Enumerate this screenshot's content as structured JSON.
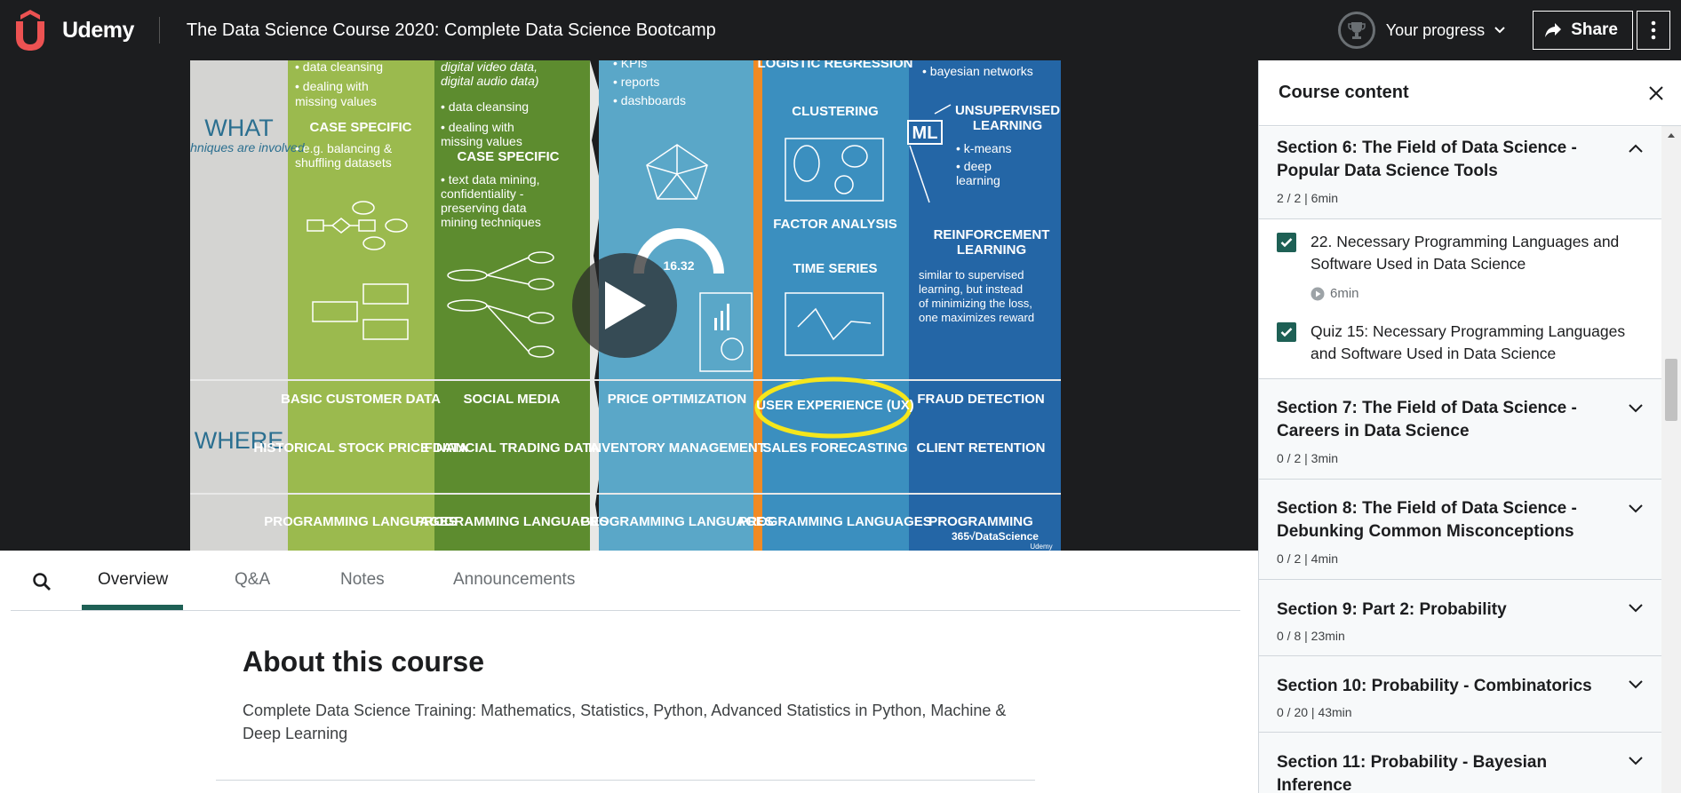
{
  "header": {
    "brand": "Udemy",
    "course_title": "The Data Science Course 2020: Complete Data Science Bootcamp",
    "progress_label": "Your progress",
    "share_label": "Share"
  },
  "video": {
    "rows": [
      "WHAT",
      "WHERE"
    ],
    "what_sub": "techniques are involved",
    "col1_top": [
      "• data cleansing",
      "• dealing with",
      "  missing values"
    ],
    "col1_case": "CASE SPECIFIC",
    "col1_case_items": [
      "• e.g. balancing &",
      "  shuffling datasets"
    ],
    "col2_top": [
      "digital video data,",
      "digital audio data)",
      "• data cleansing",
      "• dealing with",
      "  missing values"
    ],
    "col2_case": "CASE SPECIFIC",
    "col2_case_items": [
      "• text data mining,",
      "  confidentiality -",
      "  preserving data",
      "  mining techniques"
    ],
    "col3_top": [
      "• KPIs",
      "• reports",
      "• dashboards"
    ],
    "col3_gauge": "16.32",
    "col4_items": [
      "LOGISTIC REGRESSION",
      "CLUSTERING",
      "FACTOR ANALYSIS",
      "TIME SERIES"
    ],
    "col5_top": "• bayesian networks",
    "col5_ml": "ML",
    "col5_unsup": "UNSUPERVISED LEARNING",
    "col5_unsup_items": [
      "• k-means",
      "• deep",
      "  learning"
    ],
    "col5_reinf": "REINFORCEMENT LEARNING",
    "col5_reinf_desc": [
      "similar to supervised",
      "learning, but instead",
      "of minimizing the loss,",
      "one maximizes reward"
    ],
    "where_row1": [
      "BASIC CUSTOMER DATA",
      "SOCIAL MEDIA",
      "PRICE OPTIMIZATION",
      "USER EXPERIENCE (UX)",
      "FRAUD DETECTION"
    ],
    "where_row2": [
      "HISTORICAL STOCK PRICE DATA",
      "FINANCIAL TRADING DATA",
      "INVENTORY MANAGEMENT",
      "SALES FORECASTING",
      "CLIENT RETENTION"
    ],
    "bottom_row": [
      "PROGRAMMING LANGUAGES",
      "PROGRAMMING LANGUAGES",
      "PROGRAMMING LANGUAGES",
      "PROGRAMMING LANGUAGES",
      "PROGRAMMING"
    ],
    "watermark": "365√DataScience",
    "watermark_small": "Udemy"
  },
  "tabs": [
    "Overview",
    "Q&A",
    "Notes",
    "Announcements"
  ],
  "about": {
    "title": "About this course",
    "description": "Complete Data Science Training: Mathematics, Statistics, Python, Advanced Statistics in Python, Machine & Deep Learning"
  },
  "sidebar": {
    "title": "Course content",
    "sections": [
      {
        "title": "Section 6: The Field of Data Science - Popular Data Science Tools",
        "meta": "2 / 2 | 6min",
        "expanded": true
      },
      {
        "title": "Section 7: The Field of Data Science - Careers in Data Science",
        "meta": "0 / 2 | 3min"
      },
      {
        "title": "Section 8: The Field of Data Science - Debunking Common Misconceptions",
        "meta": "0 / 2 | 4min"
      },
      {
        "title": "Section 9: Part 2: Probability",
        "meta": "0 / 8 | 23min"
      },
      {
        "title": "Section 10: Probability - Combinatorics",
        "meta": "0 / 20 | 43min"
      },
      {
        "title": "Section 11: Probability - Bayesian Inference",
        "meta": ""
      }
    ],
    "lectures": [
      {
        "title": "22. Necessary Programming Languages and Software Used in Data Science",
        "duration": "6min",
        "checked": true
      },
      {
        "title": "Quiz 15: Necessary Programming Languages and Software Used in Data Science",
        "duration": "",
        "checked": true
      }
    ]
  },
  "colors": {
    "header_bg": "#1c1d1f",
    "brand_red": "#ec5252",
    "checkbox": "#1e6055",
    "col1": "#9bba4e",
    "col2": "#5d8c2f",
    "col3": "#5aa7c8",
    "col4": "#3b8fbf",
    "col5": "#2466a6",
    "highlight": "#f5e61c"
  }
}
